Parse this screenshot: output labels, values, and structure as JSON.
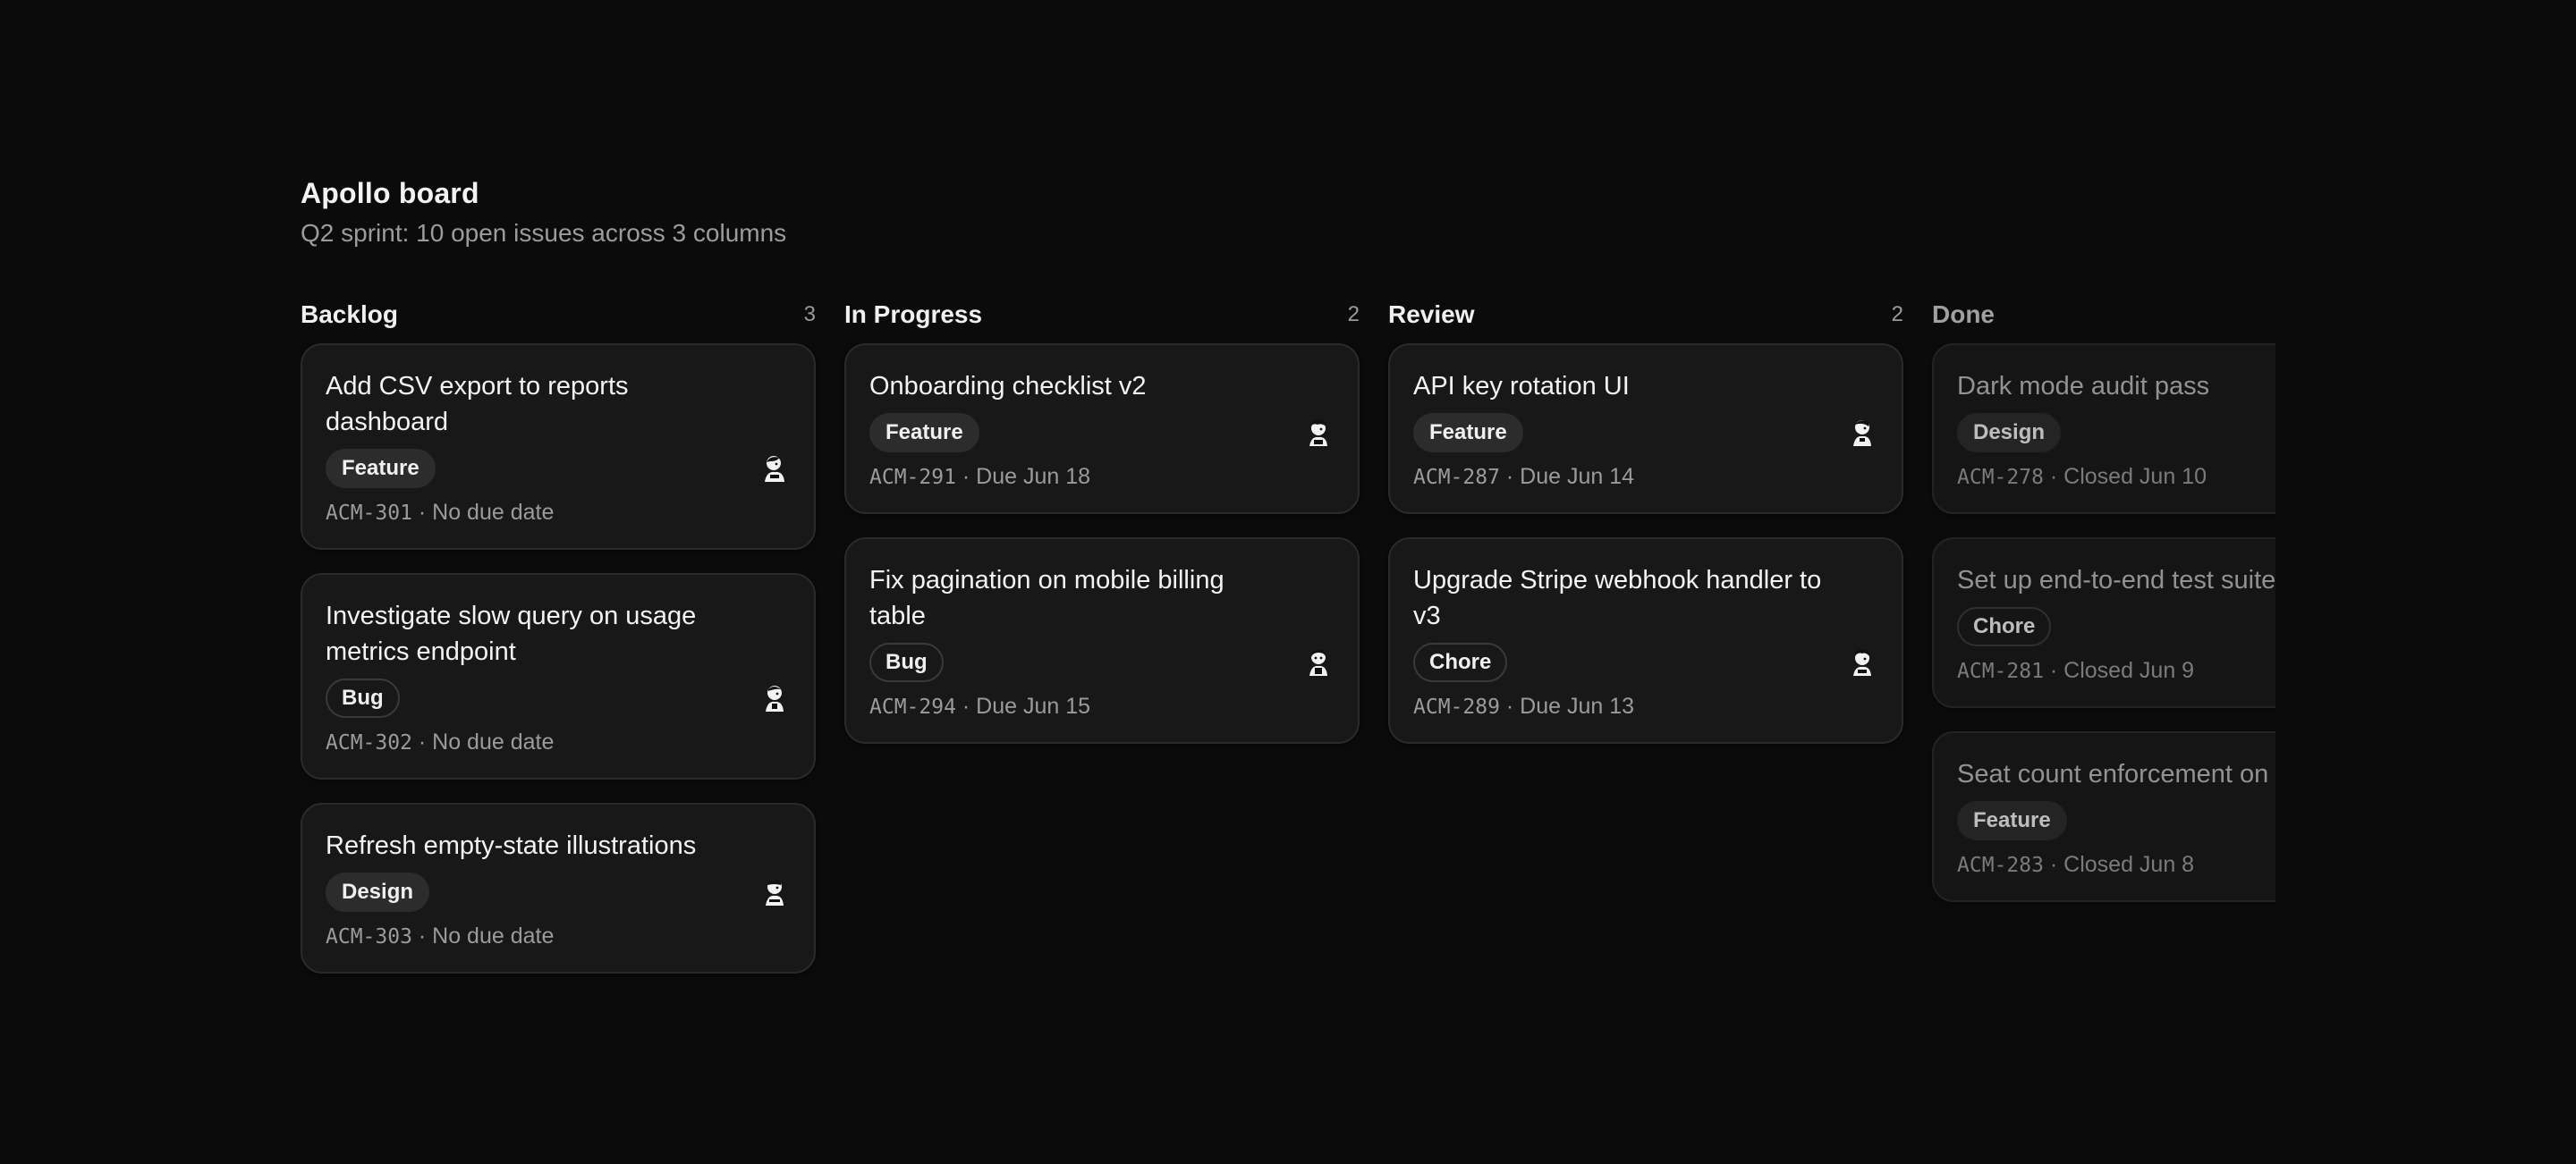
{
  "board": {
    "title": "Apollo board",
    "subtitle": "Q2 sprint: 10 open issues across 3 columns"
  },
  "columns": [
    {
      "title": "Backlog",
      "count": "3",
      "cards": [
        {
          "title": "Add CSV export to reports dashboard",
          "tag": "Feature",
          "code": "ACM-301",
          "due": "No due date"
        },
        {
          "title": "Investigate slow query on usage metrics endpoint",
          "tag": "Bug",
          "code": "ACM-302",
          "due": "No due date"
        },
        {
          "title": "Refresh empty-state illustrations",
          "tag": "Design",
          "code": "ACM-303",
          "due": "No due date"
        }
      ]
    },
    {
      "title": "In Progress",
      "count": "2",
      "cards": [
        {
          "title": "Onboarding checklist v2",
          "tag": "Feature",
          "code": "ACM-291",
          "due": "Due Jun 18"
        },
        {
          "title": "Fix pagination on mobile billing table",
          "tag": "Bug",
          "code": "ACM-294",
          "due": "Due Jun 15"
        }
      ]
    },
    {
      "title": "Review",
      "count": "2",
      "cards": [
        {
          "title": "API key rotation UI",
          "tag": "Feature",
          "code": "ACM-287",
          "due": "Due Jun 14"
        },
        {
          "title": "Upgrade Stripe webhook handler to v3",
          "tag": "Chore",
          "code": "ACM-289",
          "due": "Due Jun 13"
        }
      ]
    },
    {
      "title": "Done",
      "cards": [
        {
          "title": "Dark mode audit pass",
          "tag": "Design",
          "code": "ACM-278",
          "due": "Closed Jun 10"
        },
        {
          "title": "Set up end-to-end test suite",
          "tag": "Chore",
          "code": "ACM-281",
          "due": "Closed Jun 9"
        },
        {
          "title": "Seat count enforcement on",
          "tag": "Feature",
          "code": "ACM-283",
          "due": "Closed Jun 8"
        }
      ]
    }
  ],
  "meta_separator": " · ",
  "icons": {
    "avatar": "avatar-icon"
  },
  "colors": {
    "background": "#0b0b0b",
    "card": "#181818",
    "card_border": "#2a2a2a",
    "tag_fill": "#2c2c2c",
    "muted_text": "#9b9b9b"
  }
}
